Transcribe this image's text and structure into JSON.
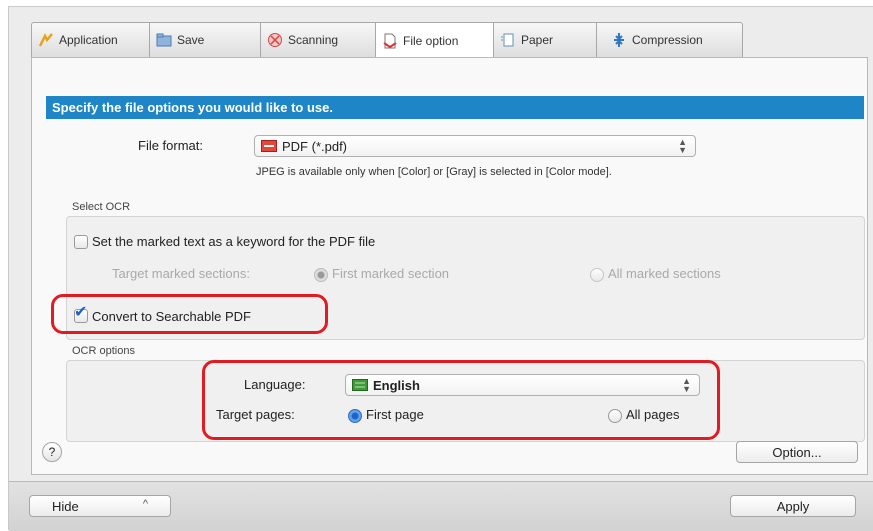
{
  "tabs": [
    {
      "label": "Application",
      "icon": "application-icon"
    },
    {
      "label": "Save",
      "icon": "save-folder-icon"
    },
    {
      "label": "Scanning",
      "icon": "scanning-icon"
    },
    {
      "label": "File option",
      "icon": "file-option-icon",
      "active": true
    },
    {
      "label": "Paper",
      "icon": "paper-icon"
    },
    {
      "label": "Compression",
      "icon": "compression-icon"
    }
  ],
  "banner": "Specify the file options you would like to use.",
  "file_format": {
    "label": "File format:",
    "value": "PDF (*.pdf)",
    "note": "JPEG is available only when [Color] or [Gray] is selected in [Color mode]."
  },
  "select_ocr": {
    "title": "Select OCR",
    "keyword_checkbox": "Set the marked text as a keyword for the PDF file",
    "keyword_checked": false,
    "target_sections_label": "Target marked sections:",
    "first_marked": "First marked section",
    "all_marked": "All marked sections",
    "searchable_checkbox": "Convert to Searchable PDF",
    "searchable_checked": true
  },
  "ocr_options": {
    "title": "OCR options",
    "language_label": "Language:",
    "language_value": "English",
    "target_pages_label": "Target pages:",
    "first_page": "First page",
    "all_pages": "All pages",
    "selected_target": "first_page"
  },
  "buttons": {
    "help": "?",
    "option": "Option...",
    "hide": "Hide",
    "apply": "Apply"
  },
  "colors": {
    "banner": "#1e86c6",
    "highlight": "#e11b22"
  }
}
